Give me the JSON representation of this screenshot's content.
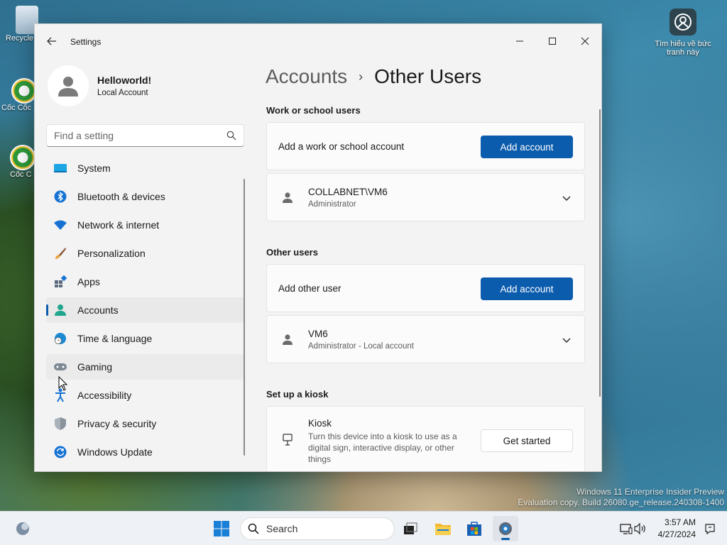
{
  "desktop": {
    "recycle_label": "Recycle",
    "coc1_label": "Cốc Cốc",
    "coc2_label": "Cốc C",
    "topright_label": "Tìm hiểu về bức tranh này",
    "eval_line1": "Windows 11 Enterprise Insider Preview",
    "eval_line2": "Evaluation copy. Build 26080.ge_release.240308-1400"
  },
  "window": {
    "app_title": "Settings",
    "controls": {
      "minimize": "—",
      "maximize": "☐",
      "close": "✕"
    }
  },
  "profile": {
    "name": "Helloworld!",
    "type": "Local Account"
  },
  "search": {
    "placeholder": "Find a setting"
  },
  "nav": {
    "items": [
      {
        "label": "System",
        "icon": "system-icon"
      },
      {
        "label": "Bluetooth & devices",
        "icon": "bluetooth-icon"
      },
      {
        "label": "Network & internet",
        "icon": "wifi-icon"
      },
      {
        "label": "Personalization",
        "icon": "brush-icon"
      },
      {
        "label": "Apps",
        "icon": "apps-icon"
      },
      {
        "label": "Accounts",
        "icon": "accounts-icon",
        "selected": true
      },
      {
        "label": "Time & language",
        "icon": "clock-globe-icon"
      },
      {
        "label": "Gaming",
        "icon": "gamepad-icon"
      },
      {
        "label": "Accessibility",
        "icon": "accessibility-icon"
      },
      {
        "label": "Privacy & security",
        "icon": "shield-icon"
      },
      {
        "label": "Windows Update",
        "icon": "update-icon"
      }
    ]
  },
  "breadcrumb": {
    "parent": "Accounts",
    "separator": "›",
    "current": "Other Users"
  },
  "work_section": {
    "title": "Work or school users",
    "add_label": "Add a work or school account",
    "add_button": "Add account",
    "user": {
      "name": "COLLABNET\\VM6",
      "role": "Administrator"
    }
  },
  "other_section": {
    "title": "Other users",
    "add_label": "Add other user",
    "add_button": "Add account",
    "user": {
      "name": "VM6",
      "role": "Administrator - Local account"
    }
  },
  "kiosk_section": {
    "title": "Set up a kiosk",
    "name": "Kiosk",
    "description": "Turn this device into a kiosk to use as a digital sign, interactive display, or other things",
    "button": "Get started"
  },
  "taskbar": {
    "search_label": "Search",
    "time": "3:57 AM",
    "date": "4/27/2024"
  },
  "colors": {
    "accent": "#0b5cad",
    "window_bg": "#f3f3f3",
    "card_bg": "#fbfbfb"
  }
}
